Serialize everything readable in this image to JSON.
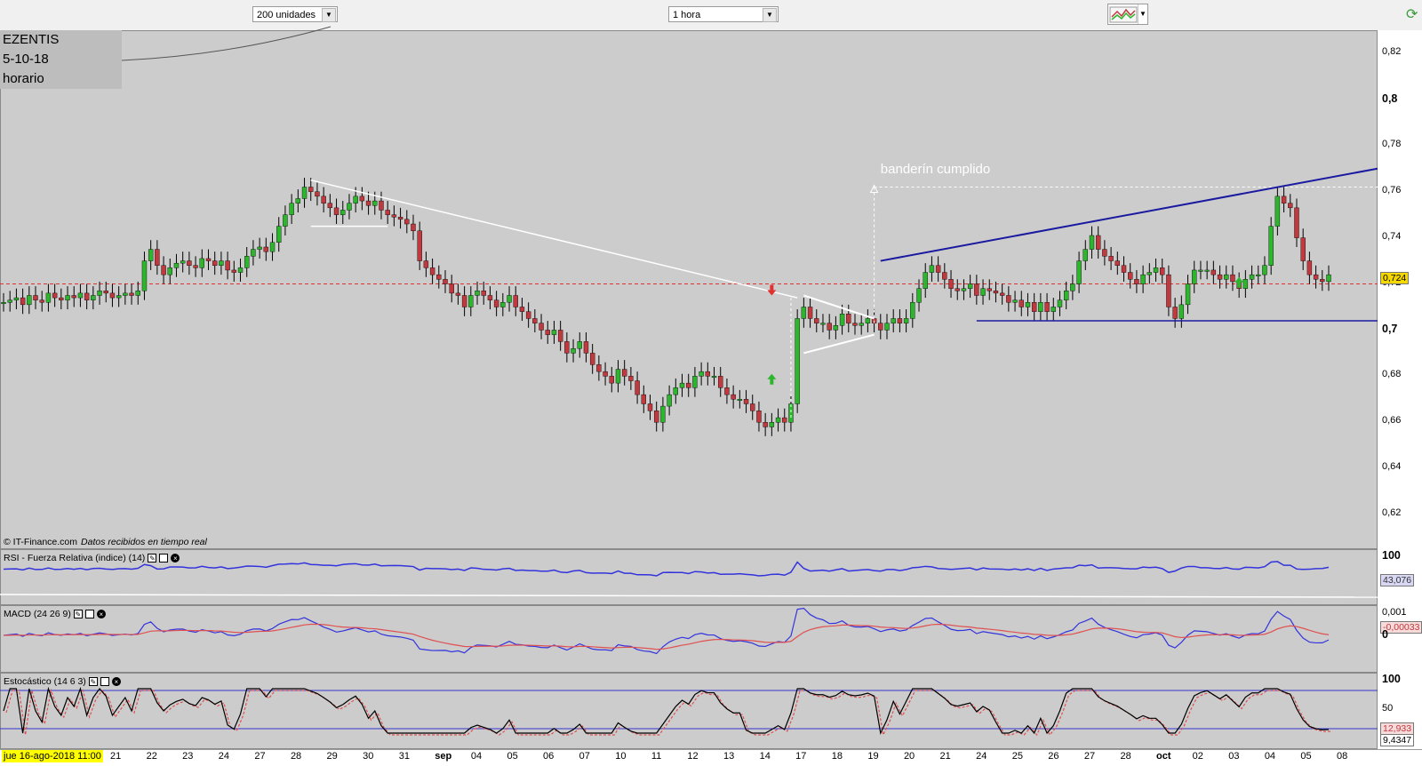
{
  "toolbar": {
    "units_select": "200 unidades",
    "interval_select": "1 hora",
    "chart_type_icon": "chart-type-icon",
    "corner_icon": "refresh-icon"
  },
  "info": {
    "line1": "EZENTIS",
    "line2": "5-10-18",
    "line3": "horario"
  },
  "credit": {
    "source": "© IT-Finance.com",
    "note": "Datos recibidos en tiempo real"
  },
  "indicators": {
    "rsi": {
      "label": "RSI - Fuerza Relativa (indice) (14)",
      "value": "43,076",
      "ticks": [
        "100"
      ]
    },
    "macd": {
      "label": "MACD (24 26 9)",
      "value": "-0,00033",
      "ticks": [
        "0,001",
        "0"
      ]
    },
    "stoch": {
      "label": "Estocástico (14 6 3)",
      "value1": "12,933",
      "value2": "9,4347",
      "ticks": [
        "100",
        "50"
      ]
    }
  },
  "colors": {
    "up": "#2db52d",
    "down": "#c0393f",
    "wick": "#000000",
    "channel": "#1a1aa0",
    "price_line": "#e03030",
    "panel_bg": "#cccccc",
    "rsi": "#3333dd",
    "macd": "#3333dd",
    "signal": "#e05050"
  },
  "chart_data": {
    "type": "candlestick",
    "title": "EZENTIS",
    "annotation": "banderín cumplido",
    "current_price_label": "0,724",
    "y_ticks": [
      {
        "value": 0.82,
        "label": "0,82",
        "bold": false
      },
      {
        "value": 0.8,
        "label": "0,8",
        "bold": true
      },
      {
        "value": 0.78,
        "label": "0,78",
        "bold": false
      },
      {
        "value": 0.76,
        "label": "0,76",
        "bold": false
      },
      {
        "value": 0.74,
        "label": "0,74",
        "bold": false
      },
      {
        "value": 0.72,
        "label": "0,72",
        "bold": false
      },
      {
        "value": 0.7,
        "label": "0,7",
        "bold": true
      },
      {
        "value": 0.68,
        "label": "0,68",
        "bold": false
      },
      {
        "value": 0.66,
        "label": "0,66",
        "bold": false
      },
      {
        "value": 0.64,
        "label": "0,64",
        "bold": false
      },
      {
        "value": 0.62,
        "label": "0,62",
        "bold": false
      }
    ],
    "ylim": [
      0.605,
      0.83
    ],
    "x_start_label": "jue 16-ago-2018 11:00",
    "x_labels": [
      {
        "label": "21",
        "bold": false
      },
      {
        "label": "22",
        "bold": false
      },
      {
        "label": "23",
        "bold": false
      },
      {
        "label": "24",
        "bold": false
      },
      {
        "label": "27",
        "bold": false
      },
      {
        "label": "28",
        "bold": false
      },
      {
        "label": "29",
        "bold": false
      },
      {
        "label": "30",
        "bold": false
      },
      {
        "label": "31",
        "bold": false
      },
      {
        "label": "sep",
        "bold": true
      },
      {
        "label": "04",
        "bold": false
      },
      {
        "label": "05",
        "bold": false
      },
      {
        "label": "06",
        "bold": false
      },
      {
        "label": "07",
        "bold": false
      },
      {
        "label": "10",
        "bold": false
      },
      {
        "label": "11",
        "bold": false
      },
      {
        "label": "12",
        "bold": false
      },
      {
        "label": "13",
        "bold": false
      },
      {
        "label": "14",
        "bold": false
      },
      {
        "label": "17",
        "bold": false
      },
      {
        "label": "18",
        "bold": false
      },
      {
        "label": "19",
        "bold": false
      },
      {
        "label": "20",
        "bold": false
      },
      {
        "label": "21",
        "bold": false
      },
      {
        "label": "24",
        "bold": false
      },
      {
        "label": "25",
        "bold": false
      },
      {
        "label": "26",
        "bold": false
      },
      {
        "label": "27",
        "bold": false
      },
      {
        "label": "28",
        "bold": false
      },
      {
        "label": "oct",
        "bold": true
      },
      {
        "label": "02",
        "bold": false
      },
      {
        "label": "03",
        "bold": false
      },
      {
        "label": "04",
        "bold": false
      },
      {
        "label": "05",
        "bold": false
      },
      {
        "label": "08",
        "bold": false
      }
    ],
    "x_index_range": [
      0,
      200
    ],
    "close_series": [
      0.712,
      0.713,
      0.714,
      0.711,
      0.715,
      0.713,
      0.712,
      0.716,
      0.714,
      0.713,
      0.715,
      0.714,
      0.716,
      0.713,
      0.715,
      0.717,
      0.716,
      0.714,
      0.715,
      0.716,
      0.715,
      0.717,
      0.73,
      0.735,
      0.728,
      0.724,
      0.727,
      0.729,
      0.73,
      0.728,
      0.727,
      0.731,
      0.73,
      0.728,
      0.73,
      0.726,
      0.725,
      0.727,
      0.732,
      0.735,
      0.736,
      0.734,
      0.738,
      0.745,
      0.75,
      0.755,
      0.757,
      0.762,
      0.76,
      0.758,
      0.755,
      0.753,
      0.75,
      0.752,
      0.755,
      0.758,
      0.756,
      0.754,
      0.756,
      0.752,
      0.75,
      0.749,
      0.748,
      0.746,
      0.743,
      0.73,
      0.727,
      0.724,
      0.722,
      0.72,
      0.716,
      0.715,
      0.71,
      0.715,
      0.717,
      0.715,
      0.713,
      0.71,
      0.712,
      0.715,
      0.71,
      0.708,
      0.705,
      0.703,
      0.7,
      0.698,
      0.7,
      0.695,
      0.69,
      0.692,
      0.695,
      0.69,
      0.685,
      0.682,
      0.68,
      0.677,
      0.683,
      0.68,
      0.678,
      0.672,
      0.668,
      0.665,
      0.66,
      0.667,
      0.672,
      0.675,
      0.677,
      0.675,
      0.68,
      0.682,
      0.68,
      0.68,
      0.675,
      0.672,
      0.67,
      0.67,
      0.668,
      0.665,
      0.66,
      0.658,
      0.66,
      0.662,
      0.66,
      0.668,
      0.705,
      0.71,
      0.705,
      0.703,
      0.703,
      0.7,
      0.702,
      0.707,
      0.703,
      0.702,
      0.703,
      0.705,
      0.703,
      0.7,
      0.703,
      0.705,
      0.703,
      0.705,
      0.712,
      0.718,
      0.725,
      0.728,
      0.725,
      0.722,
      0.718,
      0.717,
      0.718,
      0.72,
      0.715,
      0.718,
      0.717,
      0.716,
      0.715,
      0.712,
      0.713,
      0.71,
      0.712,
      0.708,
      0.712,
      0.708,
      0.71,
      0.713,
      0.717,
      0.72,
      0.73,
      0.735,
      0.741,
      0.735,
      0.732,
      0.73,
      0.728,
      0.725,
      0.722,
      0.72,
      0.724,
      0.725,
      0.727,
      0.724,
      0.71,
      0.705,
      0.711,
      0.72,
      0.726,
      0.726,
      0.726,
      0.724,
      0.722,
      0.724,
      0.721,
      0.718,
      0.722,
      0.724,
      0.724,
      0.728,
      0.745,
      0.758,
      0.755,
      0.753,
      0.74,
      0.73,
      0.724,
      0.722,
      0.721,
      0.724
    ]
  }
}
